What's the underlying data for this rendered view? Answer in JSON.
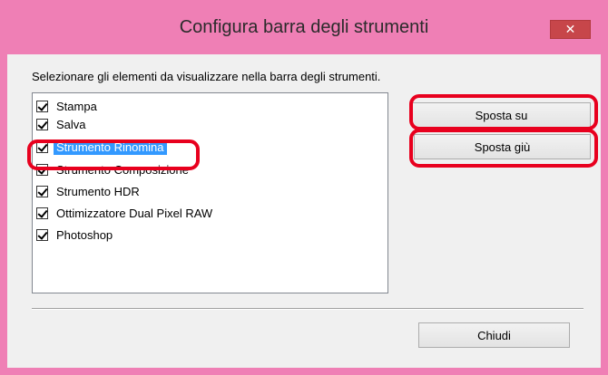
{
  "window": {
    "title": "Configura barra degli strumenti",
    "close_glyph": "✕",
    "accent_color": "#ef7fb5"
  },
  "dialog": {
    "instruction": "Selezionare gli elementi da visualizzare nella barra degli strumenti.",
    "items": [
      {
        "label": "Stampa",
        "checked": true,
        "selected": false
      },
      {
        "label": "Salva",
        "checked": true,
        "selected": false
      },
      {
        "label": "Strumento Rinomina",
        "checked": true,
        "selected": true
      },
      {
        "label": "Strumento Composizione",
        "checked": true,
        "selected": false
      },
      {
        "label": "Strumento HDR",
        "checked": true,
        "selected": false
      },
      {
        "label": "Ottimizzatore Dual Pixel RAW",
        "checked": true,
        "selected": false
      },
      {
        "label": "Photoshop",
        "checked": true,
        "selected": false
      }
    ],
    "move_up_label": "Sposta su",
    "move_down_label": "Sposta giù",
    "close_label": "Chiudi",
    "highlight_color": "#e8001e"
  }
}
